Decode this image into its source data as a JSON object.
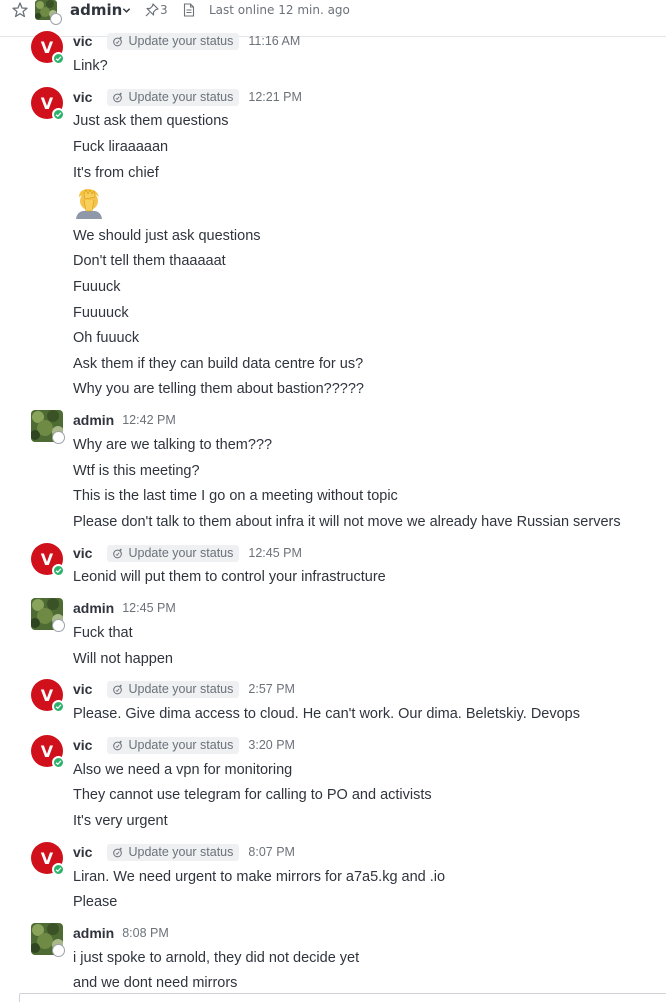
{
  "header": {
    "room_name": "admin",
    "pinned_count": "3",
    "last_online": "Last online 12 min. ago",
    "icons": [
      "star-icon",
      "chevron-down-icon",
      "pin-icon",
      "document-icon"
    ]
  },
  "status_label": "Update your status",
  "colors": {
    "vic_avatar": "#d0111b",
    "online": "#2cb26b",
    "pill_bg": "#eef0f2"
  },
  "messages": [
    {
      "user": "vic",
      "time": "11:16 AM",
      "lines": [
        "Link?"
      ]
    },
    {
      "user": "vic",
      "time": "12:21 PM",
      "lines": [
        "Just ask them questions",
        "Fuck liraaaaan",
        "It's from chief",
        "We should just ask questions",
        "Don't tell them thaaaaat",
        "Fuuuck",
        "Fuuuuck",
        "Oh fuuuck",
        "Ask them if they can build data centre for us?",
        "Why you are telling them about bastion?????"
      ],
      "emoji": "face-palm-emoji"
    },
    {
      "user": "admin",
      "time": "12:42 PM",
      "lines": [
        "Why are we talking to them???",
        "Wtf is this meeting?",
        "This is the last time I go on a meeting without topic",
        "Please don't talk to them about infra it will not move we already have Russian servers"
      ]
    },
    {
      "user": "vic",
      "time": "12:45 PM",
      "lines": [
        "Leonid will put them to control your infrastructure"
      ]
    },
    {
      "user": "admin",
      "time": "12:45 PM",
      "lines": [
        "Fuck that",
        "Will not happen"
      ]
    },
    {
      "user": "vic",
      "time": "2:57 PM",
      "lines": [
        "Please. Give dima access to cloud. He can't work. Our dima. Beletskiy. Devops"
      ]
    },
    {
      "user": "vic",
      "time": "3:20 PM",
      "lines": [
        "Also we need a vpn for monitoring",
        "They cannot use telegram for calling to PO and activists",
        "It's very urgent"
      ]
    },
    {
      "user": "vic",
      "time": "8:07 PM",
      "lines": [
        "Liran. We need urgent to make mirrors for a7a5.kg and .io",
        "Please"
      ]
    },
    {
      "user": "admin",
      "time": "8:08 PM",
      "lines": [
        "i just spoke to arnold, they did not decide yet",
        "and we dont need mirrors"
      ]
    }
  ]
}
